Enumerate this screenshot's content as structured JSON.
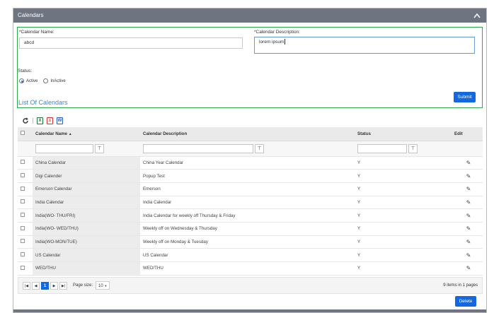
{
  "panel": {
    "title": "Calendars"
  },
  "form": {
    "name_label": "*Calendar Name:",
    "name_value": "abcd",
    "desc_label": "*Calendar Description:",
    "desc_value": "lorem ipsum",
    "status_label": "Status:",
    "status_options": [
      "Active",
      "InActive"
    ],
    "status_selected": "Active",
    "submit_label": "Submit"
  },
  "list": {
    "title": "List Of Calendars",
    "toolbar_icons": [
      "refresh-icon",
      "excel-icon",
      "pdf-icon",
      "word-icon"
    ],
    "columns": [
      "Calendar Name",
      "Calendar Description",
      "Status",
      "Edit"
    ],
    "rows": [
      {
        "name": "China Calendar",
        "desc": "China Year Calendar",
        "status": "Y"
      },
      {
        "name": "Digi Calender",
        "desc": "Popup Test",
        "status": "Y"
      },
      {
        "name": "Emerson Calendar",
        "desc": "Emerson",
        "status": "Y"
      },
      {
        "name": "India Calendar",
        "desc": "India Calendar",
        "status": "Y"
      },
      {
        "name": "India(WO- THU/FRI)",
        "desc": "India Calendar for weekly off Thursday & Friday",
        "status": "Y"
      },
      {
        "name": "India(WO- WED/THU)",
        "desc": "Weekly off on Wednesday & Thursday",
        "status": "Y"
      },
      {
        "name": "India(WO-MON/TUE)",
        "desc": "Weekly off on Monday & Tuesday",
        "status": "Y"
      },
      {
        "name": "US Calendar",
        "desc": "US Calendar",
        "status": "Y"
      },
      {
        "name": "WED/THU",
        "desc": "WED/THU",
        "status": "Y"
      }
    ]
  },
  "pager": {
    "current_page": "1",
    "page_size_label": "Page size:",
    "page_size": "10",
    "items_info": "9 items in 1 pages"
  },
  "delete_label": "Delete",
  "colors": {
    "header": "#6e7580",
    "accent": "#1268e0",
    "form_border": "#2ea84a",
    "link": "#3a87d6"
  }
}
